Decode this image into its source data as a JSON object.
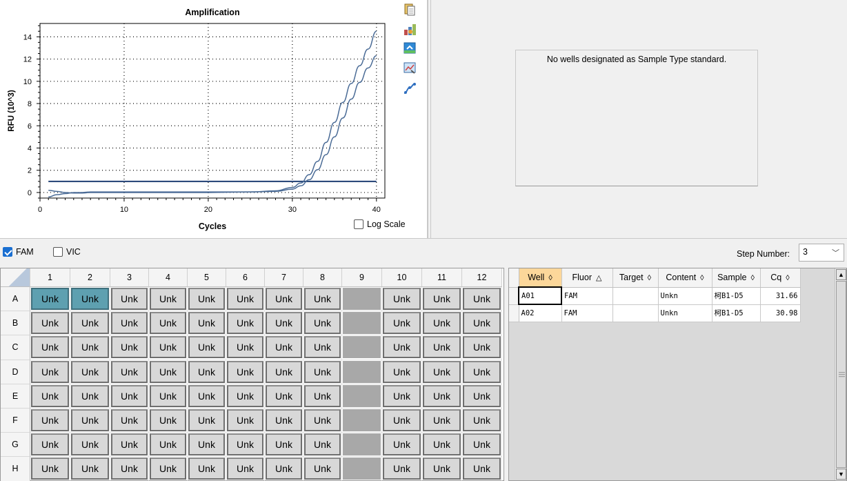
{
  "chart_data": {
    "type": "line",
    "title": "Amplification",
    "xlabel": "Cycles",
    "ylabel": "RFU (10^3)",
    "xlim": [
      0,
      41
    ],
    "ylim": [
      -0.5,
      15.2
    ],
    "xticks": [
      0,
      10,
      20,
      30,
      40
    ],
    "yticks": [
      0,
      2,
      4,
      6,
      8,
      10,
      12,
      14
    ],
    "grid": true,
    "log_scale": false,
    "threshold": 1.0,
    "threshold_color": "#1f3f73",
    "series_color": "#4a6b96",
    "series": [
      {
        "x": [
          1,
          2,
          3,
          4,
          5,
          6,
          8,
          10,
          15,
          20,
          25,
          28,
          30,
          31,
          32,
          33,
          34,
          35,
          36,
          37,
          38,
          39,
          40
        ],
        "y": [
          0.2,
          0.1,
          0.0,
          -0.05,
          -0.05,
          0.0,
          0.0,
          0.0,
          0.0,
          0.0,
          0.05,
          0.15,
          0.45,
          0.85,
          1.6,
          2.8,
          4.5,
          6.3,
          8.1,
          9.8,
          11.4,
          12.9,
          14.5
        ]
      },
      {
        "x": [
          1,
          2,
          3,
          4,
          5,
          6,
          8,
          10,
          15,
          20,
          25,
          28,
          30,
          31,
          32,
          33,
          34,
          35,
          36,
          37,
          38,
          39,
          40
        ],
        "y": [
          -0.4,
          -0.2,
          -0.1,
          0.0,
          0.0,
          0.05,
          0.05,
          0.05,
          0.05,
          0.05,
          0.05,
          0.1,
          0.3,
          0.6,
          1.15,
          2.05,
          3.4,
          5.0,
          6.7,
          8.4,
          9.9,
          11.2,
          12.3
        ]
      }
    ]
  },
  "chart_controls": {
    "log_scale_label": "Log Scale"
  },
  "tools": [
    "copy-icon",
    "export-chart-icon",
    "refresh-icon",
    "chart-settings-icon",
    "curve-fit-icon"
  ],
  "standard_curve": {
    "message": "No wells designated as Sample Type standard."
  },
  "fluors": [
    {
      "label": "FAM",
      "checked": true
    },
    {
      "label": "VIC",
      "checked": false
    }
  ],
  "step": {
    "label": "Step Number:",
    "value": "3"
  },
  "plate": {
    "columns": [
      "1",
      "2",
      "3",
      "4",
      "5",
      "6",
      "7",
      "8",
      "9",
      "10",
      "11",
      "12"
    ],
    "rows": [
      "A",
      "B",
      "C",
      "D",
      "E",
      "F",
      "G",
      "H"
    ],
    "well_label": "Unk",
    "empty_column": "9",
    "selected_wells": [
      "A1",
      "A2"
    ]
  },
  "results": {
    "columns": [
      {
        "label": "Well",
        "arrow": "◊",
        "sorted": true
      },
      {
        "label": "Fluor",
        "arrow": "△",
        "sorted": false
      },
      {
        "label": "Target",
        "arrow": "◊",
        "sorted": false
      },
      {
        "label": "Content",
        "arrow": "◊",
        "sorted": false
      },
      {
        "label": "Sample",
        "arrow": "◊",
        "sorted": false
      },
      {
        "label": "Cq",
        "arrow": "◊",
        "sorted": false
      }
    ],
    "rows": [
      {
        "well": "A01",
        "fluor": "FAM",
        "target": "",
        "content": "Unkn",
        "sample": "柯B1-D5",
        "cq": "31.66"
      },
      {
        "well": "A02",
        "fluor": "FAM",
        "target": "",
        "content": "Unkn",
        "sample": "柯B1-D5",
        "cq": "30.98"
      }
    ]
  }
}
